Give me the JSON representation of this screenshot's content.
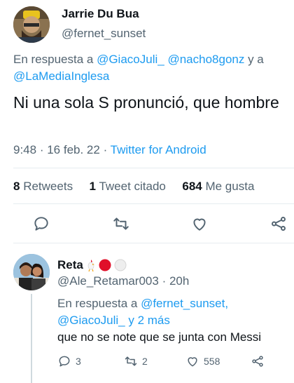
{
  "main": {
    "author_name": "Jarrie Du Bua",
    "author_handle": "@fernet_sunset",
    "reply_prefix": "En respuesta a ",
    "reply_mentions": [
      "@GiacoJuli_",
      "@nacho8gonz"
    ],
    "reply_and": " y a",
    "reply_mention_last": "@LaMediaInglesa",
    "text": "Ni una sola S pronunció, que hombre",
    "time": "9:48",
    "date": "16 feb. 22",
    "source": "Twitter for Android",
    "retweets_count": "8",
    "retweets_label": "Retweets",
    "quotes_count": "1",
    "quotes_label": "Tweet citado",
    "likes_count": "684",
    "likes_label": "Me gusta"
  },
  "reply": {
    "author_name": "Reta",
    "author_handle": "@Ale_Retamar003",
    "age": "20h",
    "reply_prefix": "En respuesta a ",
    "reply_mention_1": "@fernet_sunset,",
    "reply_mention_2": "@GiacoJuli_",
    "reply_more": "y 2 más",
    "text": "que no se note que se junta con Messi",
    "replies_count": "3",
    "retweets_count": "2",
    "likes_count": "558"
  },
  "colors": {
    "link": "#1d9bf0",
    "secondary": "#536471",
    "primary": "#0f1419",
    "name_badge_red": "#e0102a"
  },
  "icons": [
    "reply-icon",
    "retweet-icon",
    "like-icon",
    "share-icon"
  ]
}
